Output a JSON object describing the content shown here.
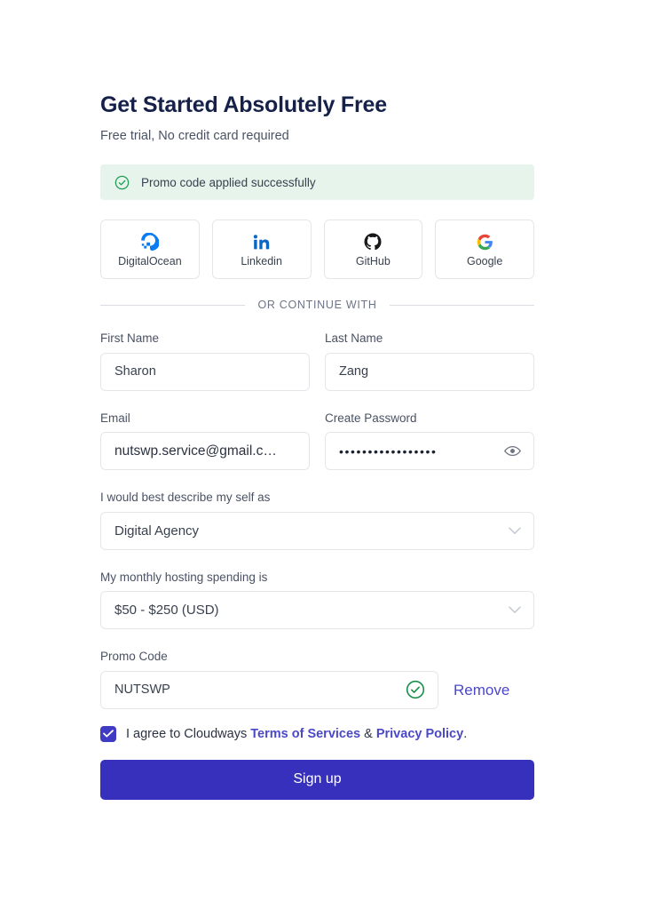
{
  "header": {
    "title": "Get Started Absolutely Free",
    "subtitle": "Free trial, No credit card required"
  },
  "promo_banner": {
    "icon": "check-circle-icon",
    "message": "Promo code applied successfully",
    "background_color": "#e6f4ec",
    "icon_color": "#1f9d55"
  },
  "social_logins": [
    {
      "label": "DigitalOcean",
      "icon": "digitalocean-icon",
      "color": "#0a7bf2"
    },
    {
      "label": "Linkedin",
      "icon": "linkedin-icon",
      "color": "#0a66c2"
    },
    {
      "label": "GitHub",
      "icon": "github-icon",
      "color": "#18181b"
    },
    {
      "label": "Google",
      "icon": "google-icon",
      "color": "#4285f4"
    }
  ],
  "divider": {
    "text": "OR CONTINUE WITH"
  },
  "fields": {
    "first_name": {
      "label": "First Name",
      "value": "Sharon",
      "placeholder": "First Name"
    },
    "last_name": {
      "label": "Last Name",
      "value": "Zang",
      "placeholder": "Last Name"
    },
    "email": {
      "label": "Email",
      "value": "nutswp.service@gmail.c…",
      "placeholder": "Email"
    },
    "password": {
      "label": "Create Password",
      "value": "•••••••••••••••••",
      "placeholder": "Create Password",
      "toggle_icon": "eye-icon"
    },
    "describe": {
      "label": "I would best describe my self as",
      "value": "Digital Agency",
      "chevron_icon": "chevron-down-icon"
    },
    "spending": {
      "label": "My monthly hosting spending is",
      "value": "$50 - $250 (USD)",
      "chevron_icon": "chevron-down-icon"
    },
    "promo_code": {
      "label": "Promo Code",
      "value": "NUTSWP",
      "placeholder": "Promo Code",
      "valid_icon": "check-circle-icon",
      "remove_label": "Remove"
    }
  },
  "agreement": {
    "checked": true,
    "prefix": "I agree to Cloudways ",
    "terms_link": "Terms of Services",
    "separator": " & ",
    "privacy_link": "Privacy Policy",
    "suffix": "."
  },
  "submit": {
    "label": "Sign up",
    "color": "#3730bd"
  },
  "theme": {
    "accent": "#3730bd",
    "link": "#4b48c8",
    "heading": "#16214a",
    "success": "#1f9d55",
    "border": "#e4e6ea"
  }
}
